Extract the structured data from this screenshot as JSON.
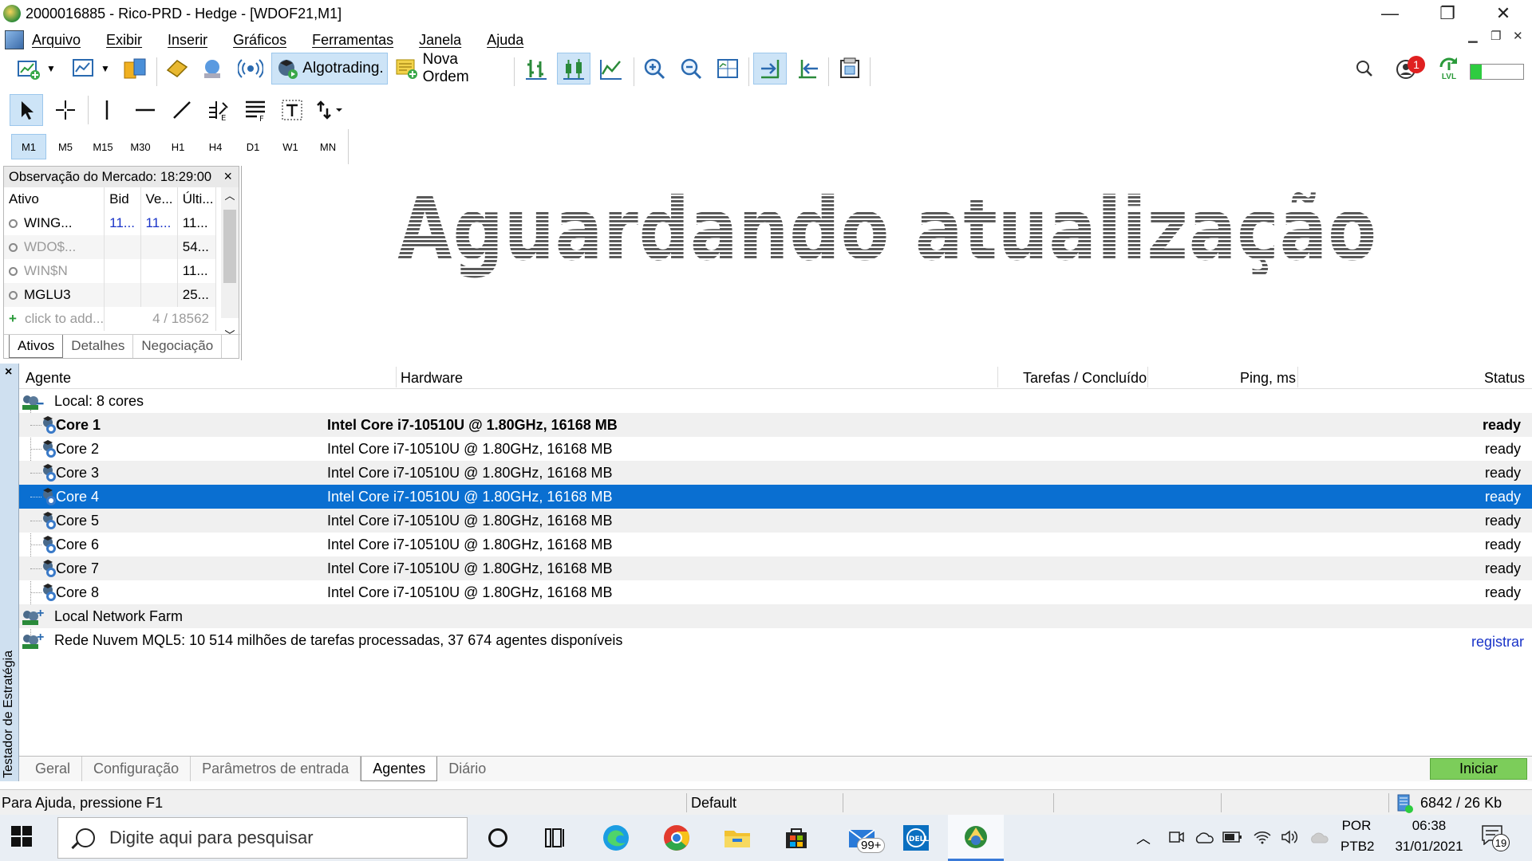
{
  "window": {
    "title": "2000016885 - Rico-PRD - Hedge - [WDOF21,M1]",
    "minimize": "—",
    "maximize": "❐",
    "close": "✕"
  },
  "menu": [
    "Arquivo",
    "Exibir",
    "Inserir",
    "Gráficos",
    "Ferramentas",
    "Janela",
    "Ajuda"
  ],
  "toolbar": {
    "algotrading_label": "Algotrading.",
    "nova_ordem_label": "Nova Ordem",
    "notification_count": "1",
    "lvl_label": "LVL"
  },
  "timeframes": [
    "M1",
    "M5",
    "M15",
    "M30",
    "H1",
    "H4",
    "D1",
    "W1",
    "MN"
  ],
  "timeframe_selected": "M1",
  "market_watch": {
    "title": "Observação do Mercado: 18:29:00",
    "close": "×",
    "columns": [
      "Ativo",
      "Bid",
      "Ve...",
      "Últi..."
    ],
    "rows": [
      {
        "symbol": "WING...",
        "bid": "11...",
        "ve": "11...",
        "last": "11..."
      },
      {
        "symbol": "WDO$...",
        "bid": "",
        "ve": "",
        "last": "54..."
      },
      {
        "symbol": "WIN$N",
        "bid": "",
        "ve": "",
        "last": "11..."
      },
      {
        "symbol": "MGLU3",
        "bid": "",
        "ve": "",
        "last": "25..."
      }
    ],
    "add_label": "click to add...",
    "count": "4 / 18562",
    "tabs": [
      "Ativos",
      "Detalhes",
      "Negociação"
    ]
  },
  "chart": {
    "waiting_text": "Aguardando atualização"
  },
  "tester": {
    "side_label": "Testador de Estratégia",
    "close": "×",
    "columns": [
      "Agente",
      "Hardware",
      "Tarefas / Concluído",
      "Ping, ms",
      "Status"
    ],
    "local_group": "Local: 8 cores",
    "cores": [
      {
        "name": "Core 1",
        "hardware": "Intel Core i7-10510U  @ 1.80GHz, 16168 MB",
        "status": "ready"
      },
      {
        "name": "Core 2",
        "hardware": "Intel Core i7-10510U  @ 1.80GHz, 16168 MB",
        "status": "ready"
      },
      {
        "name": "Core 3",
        "hardware": "Intel Core i7-10510U  @ 1.80GHz, 16168 MB",
        "status": "ready"
      },
      {
        "name": "Core 4",
        "hardware": "Intel Core i7-10510U  @ 1.80GHz, 16168 MB",
        "status": "ready"
      },
      {
        "name": "Core 5",
        "hardware": "Intel Core i7-10510U  @ 1.80GHz, 16168 MB",
        "status": "ready"
      },
      {
        "name": "Core 6",
        "hardware": "Intel Core i7-10510U  @ 1.80GHz, 16168 MB",
        "status": "ready"
      },
      {
        "name": "Core 7",
        "hardware": "Intel Core i7-10510U  @ 1.80GHz, 16168 MB",
        "status": "ready"
      },
      {
        "name": "Core 8",
        "hardware": "Intel Core i7-10510U  @ 1.80GHz, 16168 MB",
        "status": "ready"
      }
    ],
    "network_farm": "Local Network Farm",
    "cloud": "Rede Nuvem MQL5: 10 514 milhões de tarefas processadas, 37 674 agentes disponíveis",
    "register_link": "registrar",
    "tabs": [
      "Geral",
      "Configuração",
      "Parâmetros de entrada",
      "Agentes",
      "Diário"
    ],
    "active_tab": "Agentes",
    "start_button": "Iniciar"
  },
  "status": {
    "help": "Para Ajuda, pressione F1",
    "profile": "Default",
    "traffic": "6842 / 26 Kb"
  },
  "taskbar": {
    "search_placeholder": "Digite aqui para pesquisar",
    "mail_badge": "99+",
    "lang1": "POR",
    "lang2": "PTB2",
    "time": "06:38",
    "date": "31/01/2021",
    "notif_count": "19"
  },
  "colors": {
    "selection": "#0a6fd1",
    "start_green": "#7ccd5a",
    "link_blue": "#1a34c8"
  }
}
